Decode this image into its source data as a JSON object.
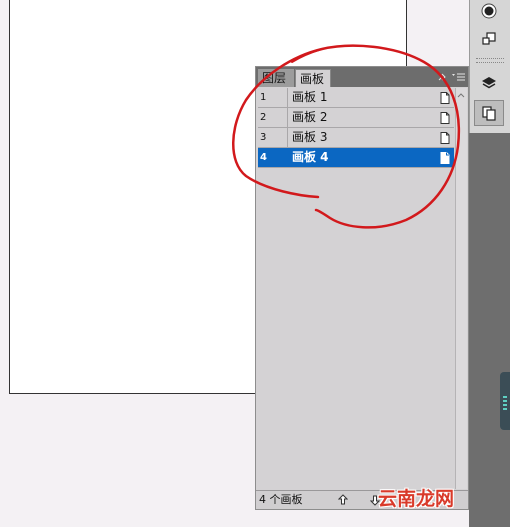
{
  "panel": {
    "tabs": [
      {
        "label": "图层"
      },
      {
        "label": "画板"
      }
    ],
    "artboards": [
      {
        "number": "1",
        "name": "画板 1"
      },
      {
        "number": "2",
        "name": "画板 2"
      },
      {
        "number": "3",
        "name": "画板 3"
      },
      {
        "number": "4",
        "name": "画板 4"
      }
    ],
    "footer": {
      "count": "4 个画板"
    }
  },
  "watermark": "云南龙网",
  "colors": {
    "selection": "#0b67c2",
    "annotation": "#d2191c",
    "watermark": "#d93a2a"
  }
}
